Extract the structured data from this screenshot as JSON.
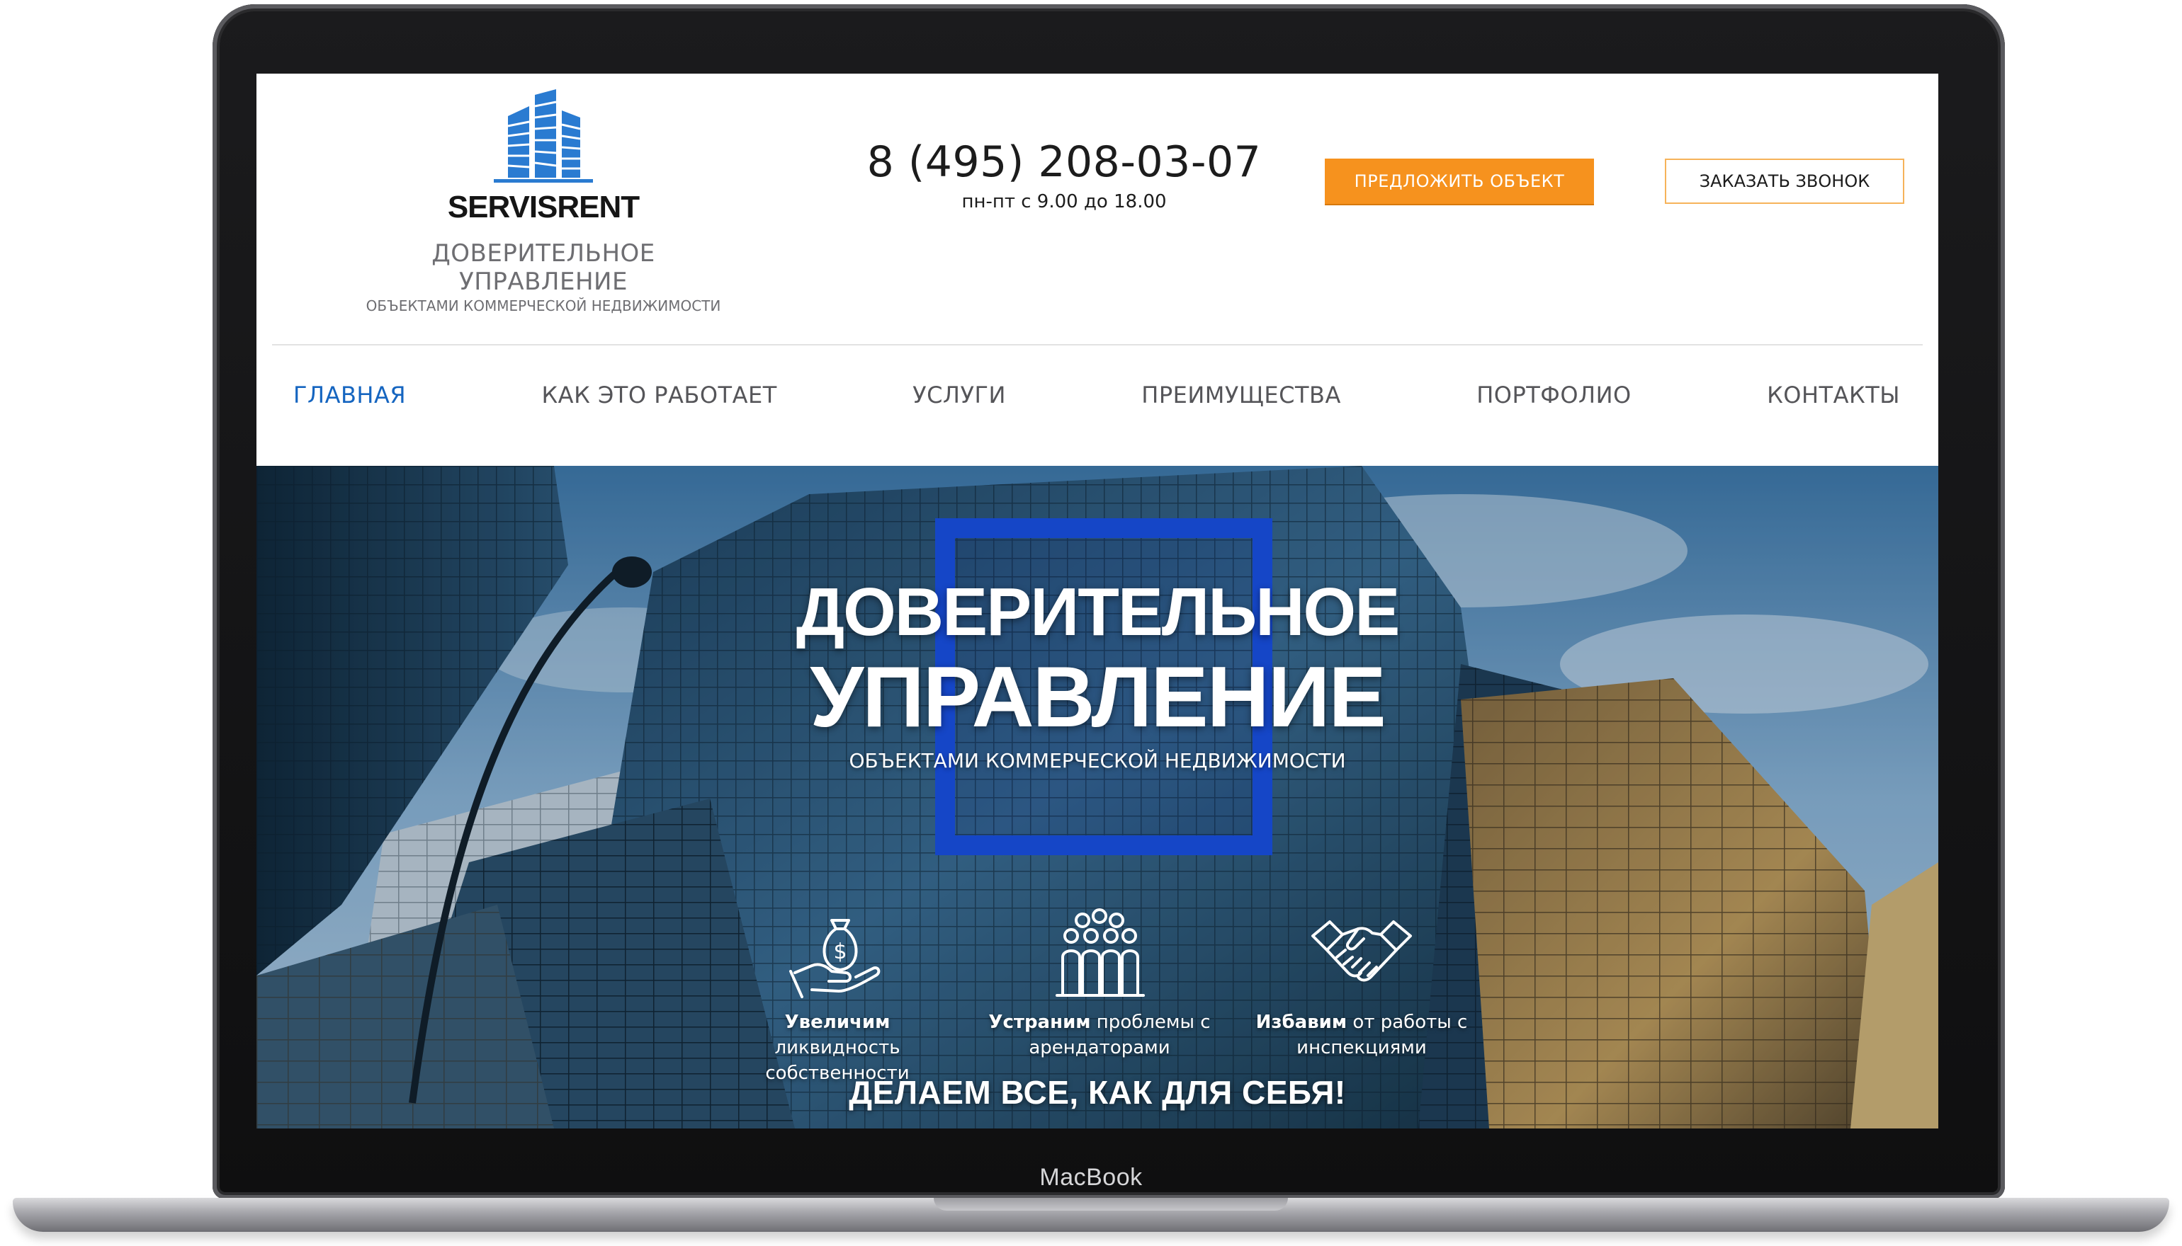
{
  "device": {
    "brand_label": "MacBook"
  },
  "header": {
    "logo": {
      "wordmark": "SERVISRENT",
      "icon": "buildings-icon",
      "tagline": "ДОВЕРИТЕЛЬНОЕ УПРАВЛЕНИЕ",
      "subtagline": "ОБЪЕКТАМИ КОММЕРЧЕСКОЙ НЕДВИЖИМОСТИ"
    },
    "phone": {
      "number": "8 (495) 208-03-07",
      "hours": "пн-пт с 9.00 до 18.00"
    },
    "buttons": {
      "offer_label": "ПРЕДЛОЖИТЬ ОБЪЕКТ",
      "call_label": "ЗАКАЗАТЬ ЗВОНОК"
    }
  },
  "nav": {
    "items": [
      {
        "label": "ГЛАВНАЯ",
        "active": true
      },
      {
        "label": "КАК ЭТО РАБОТАЕТ",
        "active": false
      },
      {
        "label": "УСЛУГИ",
        "active": false
      },
      {
        "label": "ПРЕИМУЩЕСТВА",
        "active": false
      },
      {
        "label": "ПОРТФОЛИО",
        "active": false
      },
      {
        "label": "КОНТАКТЫ",
        "active": false
      }
    ]
  },
  "hero": {
    "title_line1": "ДОВЕРИТЕЛЬНОЕ",
    "title_line2": "УПРАВЛЕНИЕ",
    "subtitle": "ОБЪЕКТАМИ КОММЕРЧЕСКОЙ НЕДВИЖИМОСТИ",
    "features": [
      {
        "icon": "money-bag-hand-icon",
        "strong": "Увеличим",
        "rest": " ликвидность",
        "line2": "собственности"
      },
      {
        "icon": "people-group-icon",
        "strong": "Устраним",
        "rest": " проблемы с",
        "line2": "арендаторами"
      },
      {
        "icon": "handshake-icon",
        "strong": "Избавим",
        "rest": " от работы с",
        "line2": "инспекциями"
      }
    ],
    "cta": "ДЕЛАЕМ ВСЕ, КАК ДЛЯ СЕБЯ!"
  },
  "colors": {
    "accent_orange": "#f6921e",
    "nav_active": "#1565c0",
    "frame_blue": "#1546c7",
    "logo_blue": "#2a7bd1"
  }
}
